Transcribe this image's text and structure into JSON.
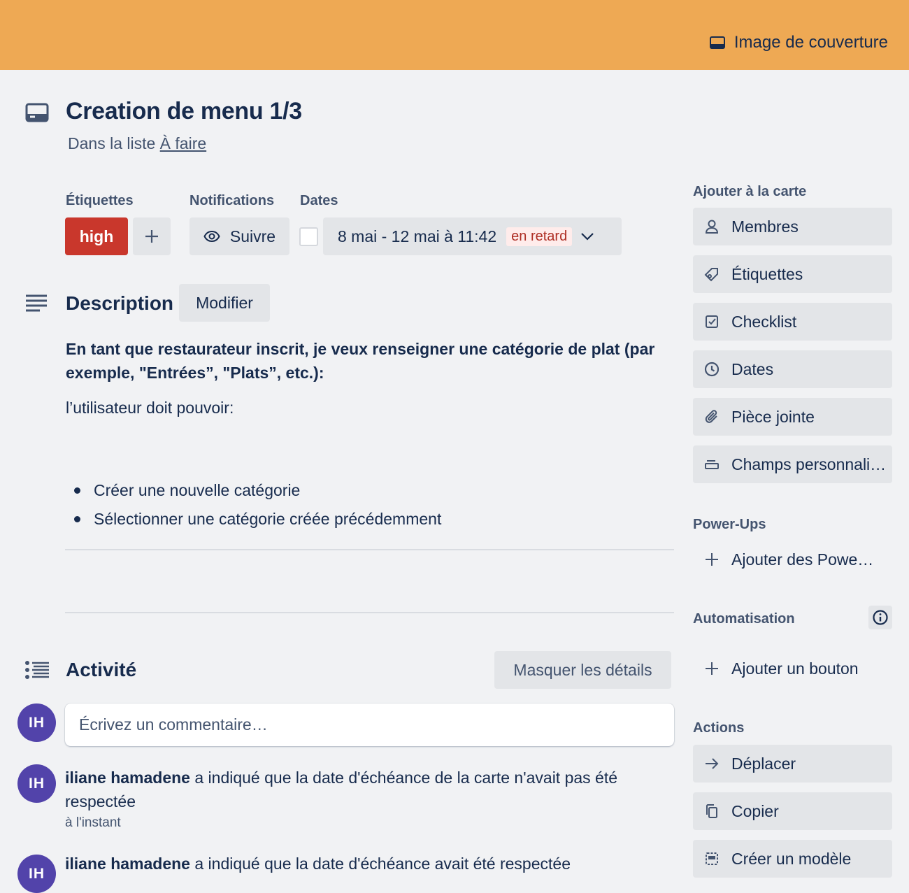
{
  "cover": {
    "button_label": "Image de couverture"
  },
  "card": {
    "title": "Creation de menu 1/3",
    "list_prefix": "Dans la liste ",
    "list_name": "À faire"
  },
  "meta": {
    "labels_heading": "Étiquettes",
    "notifications_heading": "Notifications",
    "dates_heading": "Dates",
    "label_high": "high",
    "label_high_color": "#c9372c",
    "add_label": "+",
    "watch_label": "Suivre",
    "date_range": "8 mai - 12 mai à 11:42",
    "overdue_badge": "en retard"
  },
  "description": {
    "heading": "Description",
    "edit_label": "Modifier",
    "bold_text": "En tant que restaurateur inscrit, je veux renseigner une catégorie de plat (par exemple, \"Entrées”, \"Plats”, etc.):",
    "text": "l’utilisateur doit pouvoir:",
    "bullets": [
      "Créer une nouvelle catégorie",
      "Sélectionner une catégorie créée précédemment"
    ]
  },
  "activity": {
    "heading": "Activité",
    "toggle_details": "Masquer les détails",
    "comment_placeholder": "Écrivez un commentaire…",
    "avatar_initials": "IH",
    "entries": [
      {
        "user": "iliane hamadene",
        "action": " a indiqué que la date d'échéance de la carte n'avait pas été respectée",
        "time": "à l'instant"
      },
      {
        "user": "iliane hamadene",
        "action": " a indiqué que la date d'échéance avait été respectée"
      }
    ]
  },
  "sidebar": {
    "add_heading": "Ajouter à la carte",
    "add_items": [
      {
        "label": "Membres",
        "icon": "person-icon"
      },
      {
        "label": "Étiquettes",
        "icon": "tag-icon"
      },
      {
        "label": "Checklist",
        "icon": "checklist-icon"
      },
      {
        "label": "Dates",
        "icon": "clock-icon"
      },
      {
        "label": "Pièce jointe",
        "icon": "paperclip-icon"
      },
      {
        "label": "Champs personnali…",
        "icon": "custom-fields-icon"
      }
    ],
    "powerups_heading": "Power-Ups",
    "powerups_add": "Ajouter des Powe…",
    "automation_heading": "Automatisation",
    "automation_add": "Ajouter un bouton",
    "actions_heading": "Actions",
    "actions_items": [
      {
        "label": "Déplacer",
        "icon": "arrow-right-icon"
      },
      {
        "label": "Copier",
        "icon": "copy-icon"
      },
      {
        "label": "Créer un modèle",
        "icon": "template-icon"
      }
    ]
  }
}
